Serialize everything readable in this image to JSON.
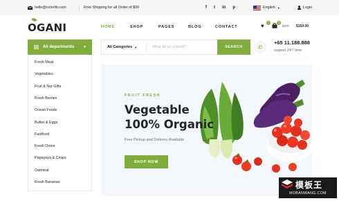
{
  "topbar": {
    "email": "hello@colorlib.com",
    "shipping": "Free Shipping for all Order of $99",
    "social": [
      "f",
      "t",
      "in",
      "p"
    ],
    "language": "English",
    "login": "Login"
  },
  "header": {
    "logo": "OGANI",
    "nav": [
      "HOME",
      "SHOP",
      "PAGES",
      "BLOG",
      "CONTACT"
    ],
    "wishlist_count": "1",
    "cart_count": "3",
    "item_label": "item:",
    "item_price": "$150.00"
  },
  "departments": {
    "title": "All departments",
    "items": [
      "Fresh Meat",
      "Vegetables",
      "Fruit & Nut Gifts",
      "Fresh Berries",
      "Ocean Foods",
      "Butter & Eggs",
      "Fastfood",
      "Fresh Onion",
      "Papayaya & Crisps",
      "Oatmeal",
      "Fresh Bananas"
    ]
  },
  "search": {
    "category": "All Categories",
    "placeholder": "What do yo u need?",
    "button": "SEARCH"
  },
  "phone": {
    "number": "+65 11.188.888",
    "support": "support 24/7 time"
  },
  "hero": {
    "eyebrow": "FRUIT FRESH",
    "title_line1": "Vegetable",
    "title_line2": "100% Organic",
    "subtitle": "Free Pickup and Delivery Available",
    "button": "SHOP NOW"
  },
  "watermark": {
    "text": "模板王",
    "url": "MOBANWANG.COM"
  },
  "colors": {
    "accent": "#7fad39",
    "dark": "#252525",
    "hero_bg": "#f3f6fa"
  },
  "icons": [
    "envelope-icon",
    "facebook-icon",
    "twitter-icon",
    "linkedin-icon",
    "pinterest-icon",
    "flag-icon",
    "user-icon",
    "heart-icon",
    "bag-icon",
    "menu-icon",
    "chevron-down-icon",
    "phone-icon"
  ]
}
